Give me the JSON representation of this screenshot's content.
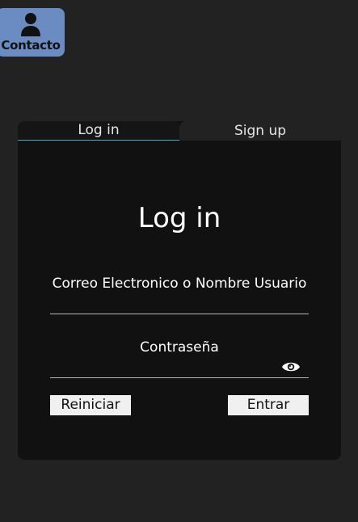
{
  "contact": {
    "label": "Contacto",
    "icon": "person-icon",
    "color": "#6b8cc2"
  },
  "tabs": [
    {
      "label": "Log in",
      "active": true
    },
    {
      "label": "Sign up",
      "active": false
    }
  ],
  "form": {
    "title": "Log in",
    "user_label": "Correo Electronico o Nombre Usuario",
    "user_value": "",
    "password_label": "Contraseña",
    "password_value": "",
    "toggle_icon": "eye-icon",
    "reset_label": "Reiniciar",
    "submit_label": "Entrar"
  },
  "colors": {
    "background": "#222222",
    "card": "#111111",
    "active_tab_underline": "#3fa9c8"
  }
}
